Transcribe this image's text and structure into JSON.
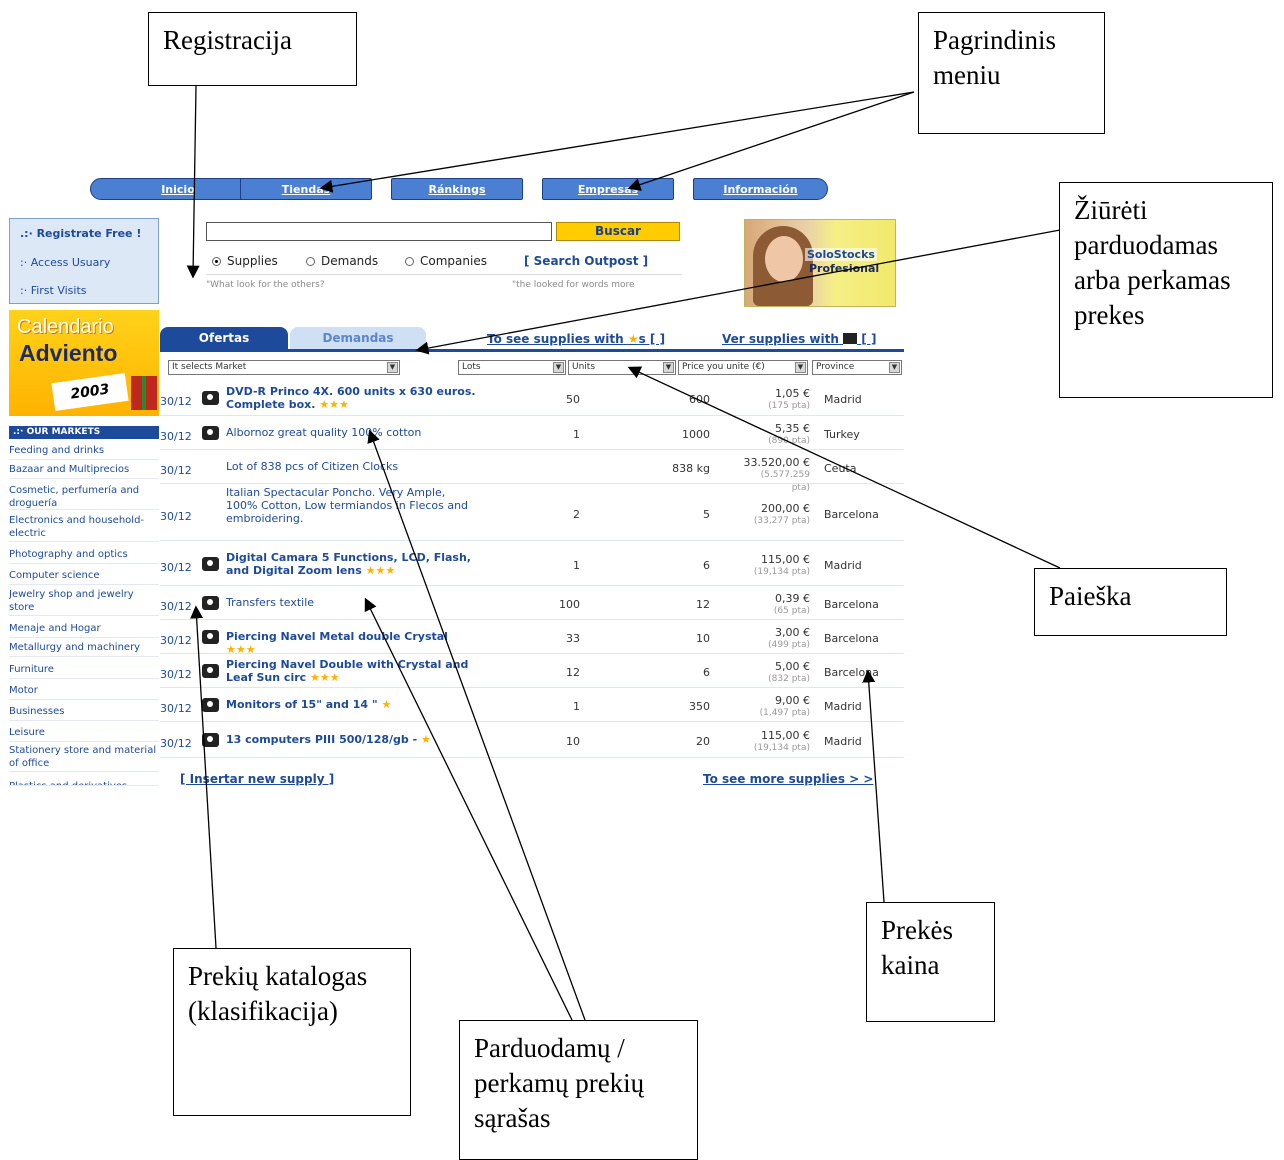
{
  "callouts": {
    "registracija": "Registracija",
    "pagrindinis_meniu": "Pagrindinis meniu",
    "ziureti": "Žiūrėti parduodamas arba perkamas prekes",
    "paieska": "Paieška",
    "prekes_kaina": "Prekės kaina",
    "prekiu_katalogas": "Prekių katalogas (klasifikacija)",
    "sarasas": "Parduodamų / perkamų prekių sąrašas"
  },
  "nav": [
    "Inicio",
    "Tiendas",
    "Ránkings",
    "Empresas",
    "Información"
  ],
  "login": {
    "registrate": ".:· Registrate Free !",
    "access": ":· Access Usuary",
    "first": ":· First Visits"
  },
  "advent": {
    "line1": "Calendario",
    "line2": "Adviento",
    "year": "2003"
  },
  "markets": {
    "header": ".:· OUR MARKETS",
    "items": [
      "Feeding and drinks",
      "Bazaar and Multiprecios",
      "Cosmetic, perfumería and droguería",
      "Electronics and household-electric",
      "Photography and optics",
      "Computer science",
      "Jewelry shop and jewelry store",
      "Menaje and Hogar",
      "Metallurgy and machinery",
      "Furniture",
      "Motor",
      "Businesses",
      "Leisure",
      "Stationery store and material of office",
      "Plastics and derivatives"
    ]
  },
  "search": {
    "button": "Buscar",
    "options": [
      "Supplies",
      "Demands",
      "Companies"
    ],
    "selected": "Supplies",
    "outpost": "[ Search Outpost ]",
    "hint_left": "\"What look for the others?",
    "hint_right": "\"the looked for words more"
  },
  "promo": {
    "brand": "SoloStocks",
    "tag": "Profesional"
  },
  "tabs": {
    "ofertas": "Ofertas",
    "demandas": "Demandas"
  },
  "links": {
    "stars": "To see supplies with",
    "stars_suffix": "s [ ]",
    "photo": "Ver supplies with",
    "photo_suffix": "[ ]"
  },
  "filters": {
    "market": "It selects Market",
    "lots": "Lots",
    "units": "Units",
    "price": "Price you unite (€)",
    "province": "Province"
  },
  "rows": [
    {
      "date": "30/12",
      "photo": true,
      "title": "DVD-R Princo 4X. 600 units x 630 euros. Complete box.",
      "bold": true,
      "stars": "★★★",
      "lots": "50",
      "units": "600",
      "price": "1,05 €",
      "pta": "(175 pta)",
      "province": "Madrid"
    },
    {
      "date": "30/12",
      "photo": true,
      "title": "Albornoz great quality 100% cotton",
      "bold": false,
      "stars": "",
      "lots": "1",
      "units": "1000",
      "price": "5,35 €",
      "pta": "(890 pta)",
      "province": "Turkey"
    },
    {
      "date": "30/12",
      "photo": false,
      "title": "Lot of 838 pcs of Citizen Clocks",
      "bold": false,
      "stars": "",
      "lots": "",
      "units": "838 kg",
      "price": "33.520,00 €",
      "pta": "(5.577.259 pta)",
      "province": "Ceuta"
    },
    {
      "date": "30/12",
      "photo": false,
      "title": "Italian Spectacular Poncho. Very Ample, 100% Cotton, Low termiandos in Flecos and embroidering.",
      "bold": false,
      "stars": "",
      "lots": "2",
      "units": "5",
      "price": "200,00 €",
      "pta": "(33,277 pta)",
      "province": "Barcelona"
    },
    {
      "date": "30/12",
      "photo": true,
      "title": "Digital Camara 5 Functions, LCD, Flash, and Digital Zoom lens",
      "bold": true,
      "stars": "★★★",
      "lots": "1",
      "units": "6",
      "price": "115,00 €",
      "pta": "(19,134 pta)",
      "province": "Madrid"
    },
    {
      "date": "30/12",
      "photo": true,
      "title": "Transfers textile",
      "bold": false,
      "stars": "",
      "lots": "100",
      "units": "12",
      "price": "0,39 €",
      "pta": "(65 pta)",
      "province": "Barcelona"
    },
    {
      "date": "30/12",
      "photo": true,
      "title": "Piercing Navel Metal double Crystal",
      "bold": true,
      "stars": "★★★",
      "lots": "33",
      "units": "10",
      "price": "3,00 €",
      "pta": "(499 pta)",
      "province": "Barcelona"
    },
    {
      "date": "30/12",
      "photo": true,
      "title": "Piercing Navel Double with Crystal and Leaf Sun circ",
      "bold": true,
      "stars": "★★★",
      "lots": "12",
      "units": "6",
      "price": "5,00 €",
      "pta": "(832 pta)",
      "province": "Barcelona"
    },
    {
      "date": "30/12",
      "photo": true,
      "title": "Monitors of 15\" and 14 \"",
      "bold": true,
      "stars": "★",
      "lots": "1",
      "units": "350",
      "price": "9,00 €",
      "pta": "(1,497 pta)",
      "province": "Madrid"
    },
    {
      "date": "30/12",
      "photo": true,
      "title": "13 computers PIII 500/128/gb -",
      "bold": true,
      "stars": "★",
      "lots": "10",
      "units": "20",
      "price": "115,00 €",
      "pta": "(19,134 pta)",
      "province": "Madrid"
    }
  ],
  "bottom": {
    "insert": "[ Insertar new supply ]",
    "more": "To see more supplies > >"
  },
  "colors": {
    "accent": "#1d4a9a",
    "button": "#ffcc00",
    "star": "#ffb100"
  }
}
